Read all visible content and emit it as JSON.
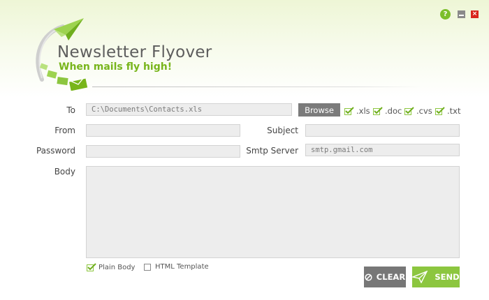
{
  "app": {
    "title": "Newsletter Flyover",
    "tagline": "When mails fly high!"
  },
  "window_controls": {
    "help_icon": "help-icon",
    "minimize_icon": "minimize-icon",
    "close_icon": "close-icon"
  },
  "form": {
    "to": {
      "label": "To",
      "value": "C:\\Documents\\Contacts.xls"
    },
    "browse_label": "Browse",
    "file_types": [
      {
        "label": ".xls",
        "checked": true
      },
      {
        "label": ".doc",
        "checked": true
      },
      {
        "label": ".cvs",
        "checked": true
      },
      {
        "label": ".txt",
        "checked": true
      }
    ],
    "from": {
      "label": "From",
      "value": ""
    },
    "subject": {
      "label": "Subject",
      "value": ""
    },
    "password": {
      "label": "Password",
      "value": ""
    },
    "smtp": {
      "label": "Smtp Server",
      "value": "smtp.gmail.com"
    },
    "body": {
      "label": "Body",
      "value": ""
    },
    "options": [
      {
        "label": "Plain Body",
        "checked": true
      },
      {
        "label": "HTML Template",
        "checked": false
      }
    ]
  },
  "actions": {
    "clear_label": "CLEAR",
    "send_label": "SEND"
  },
  "colors": {
    "accent": "#8cc63f",
    "accent_dark": "#78b51b",
    "clear_bg": "#777777",
    "close_red": "#d9251c"
  }
}
